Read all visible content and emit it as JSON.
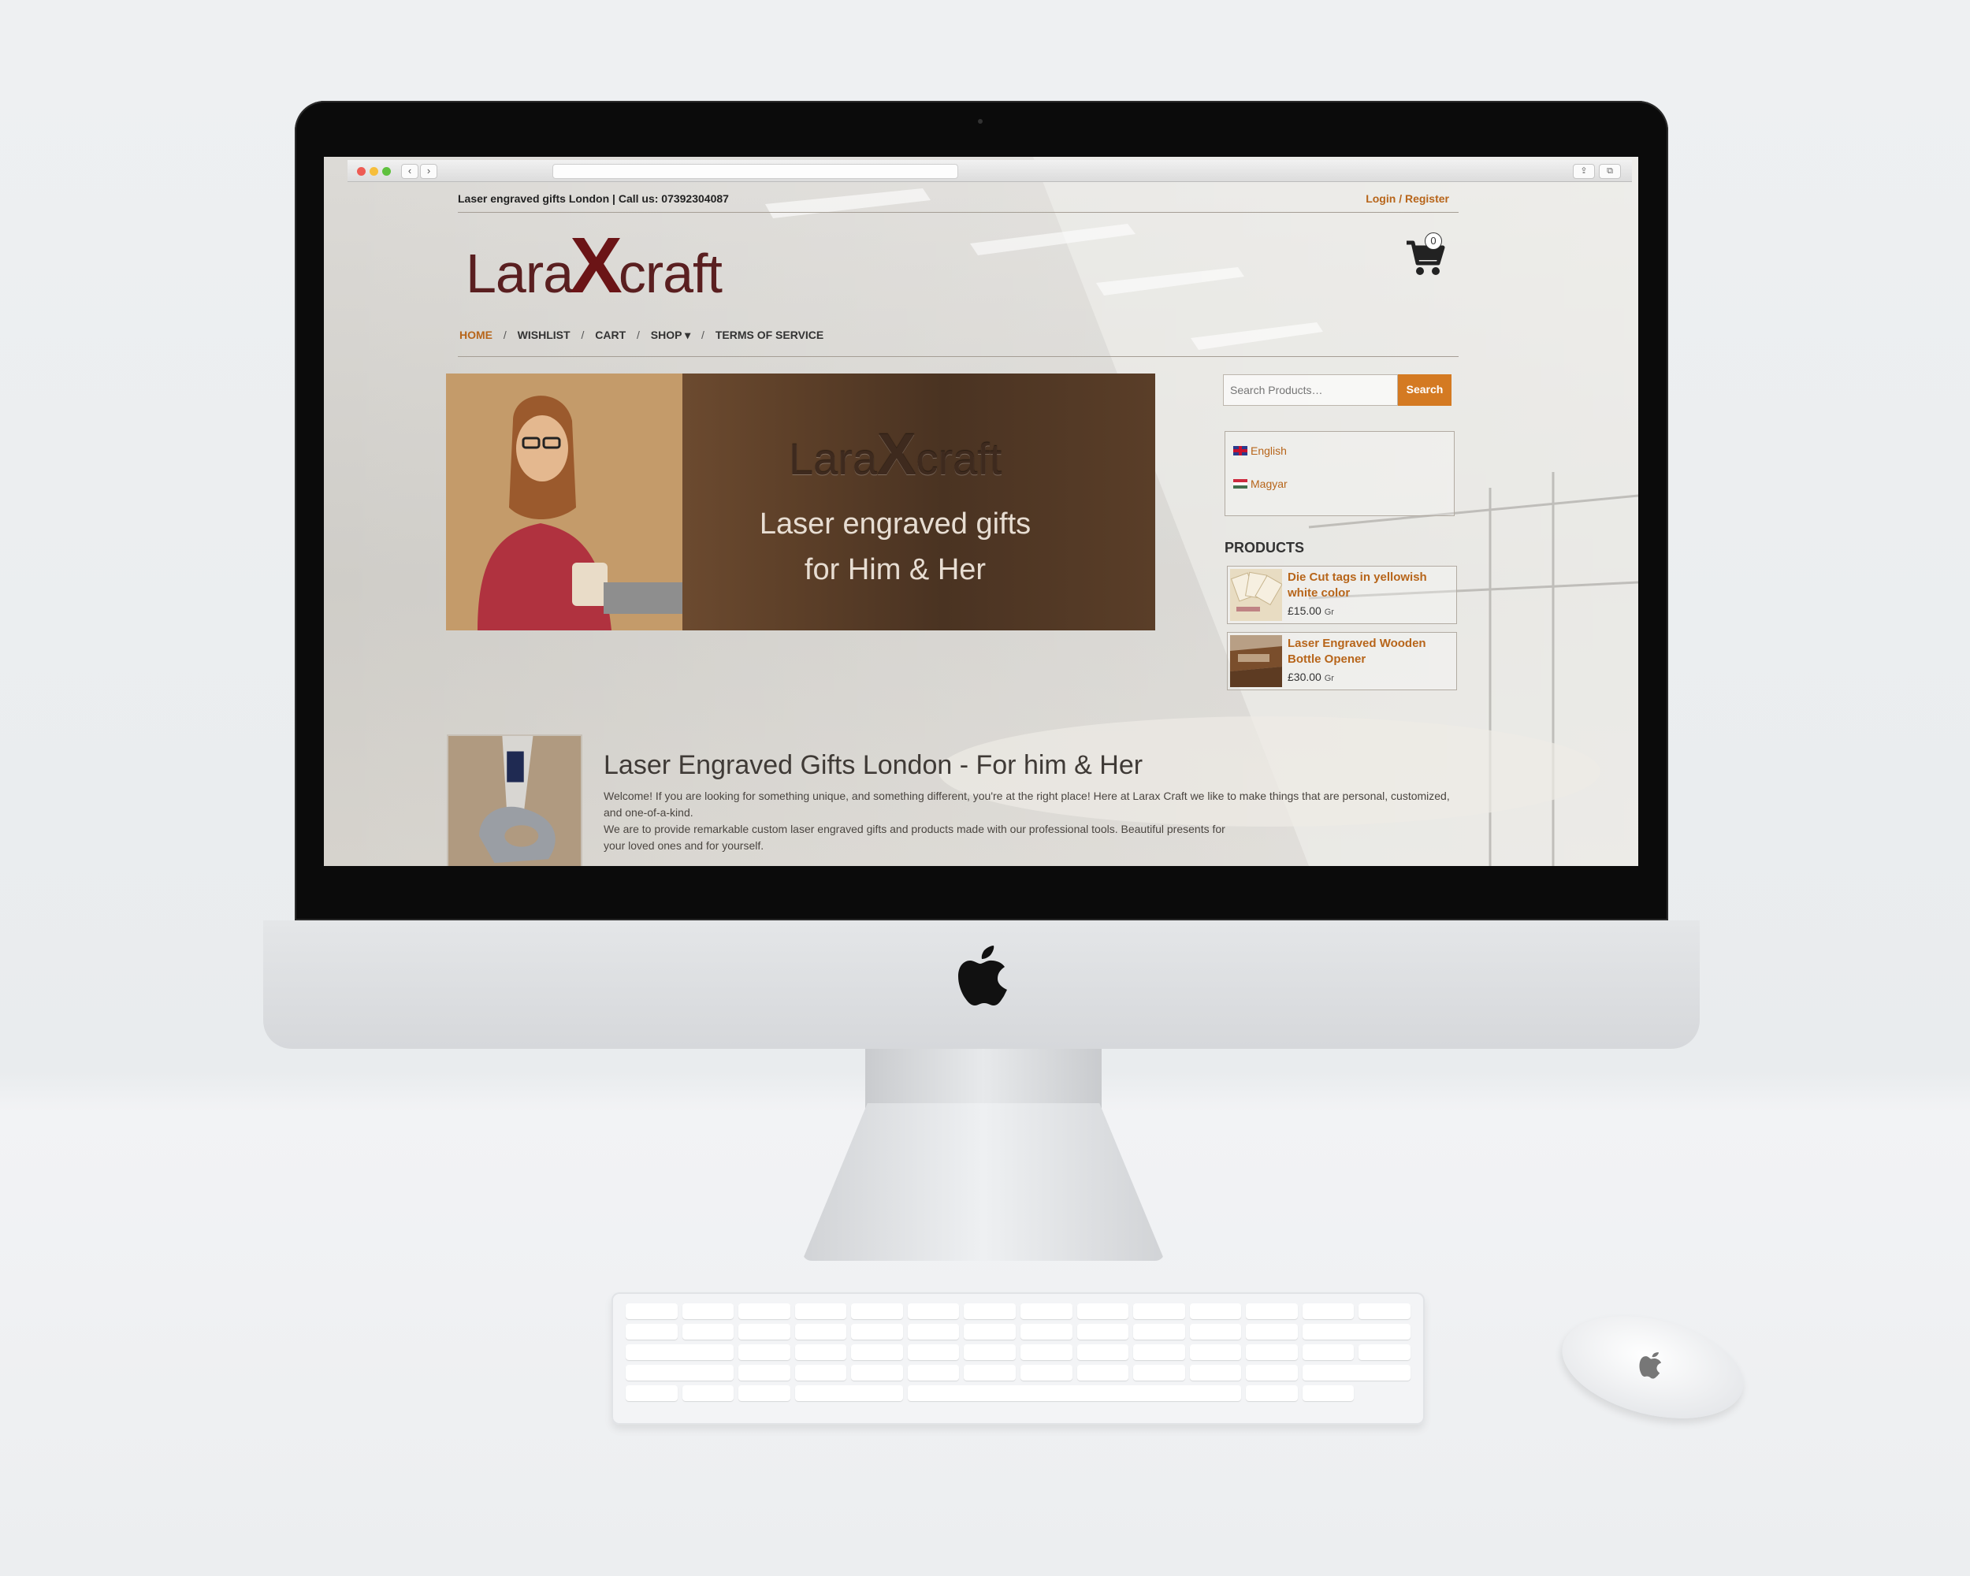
{
  "site": {
    "topbar_text": "Laser engraved gifts London | Call us: 07392304087",
    "login_link": "Login / Register",
    "logo": {
      "part1": "Lara",
      "x": "X",
      "part2": "craft"
    },
    "cart_count": "0",
    "nav": [
      {
        "label": "HOME",
        "active": true
      },
      {
        "label": "WISHLIST"
      },
      {
        "label": "CART"
      },
      {
        "label": "SHOP ▾"
      },
      {
        "label": "TERMS OF SERVICE"
      }
    ],
    "nav_separator": "/",
    "banner": {
      "logo": {
        "part1": "Lara",
        "x": "X",
        "part2": "craft"
      },
      "line1": "Laser engraved gifts",
      "line2": "for Him & Her"
    },
    "search": {
      "placeholder": "Search Products…",
      "button": "Search"
    },
    "languages": [
      "English",
      "Magyar"
    ],
    "products_title": "PRODUCTS",
    "products": [
      {
        "name": "Die Cut tags in yellowish white color",
        "price": "£15.00",
        "unit": "Gr"
      },
      {
        "name": "Laser Engraved Wooden Bottle Opener",
        "price": "£30.00",
        "unit": "Gr"
      }
    ],
    "article": {
      "title": "Laser Engraved Gifts London - For him & Her",
      "p1": "Welcome! If you are looking for something unique, and something different, you're at the right place! Here at Larax Craft we like to make things that are personal, customized, and one-of-a-kind.",
      "p2": "We are to provide remarkable custom laser engraved gifts and products made with our professional tools. Beautiful presents for your loved ones and for yourself."
    }
  },
  "colors": {
    "accent": "#b7651a",
    "search_button": "#d47a22",
    "logo": "#5a1f20"
  },
  "icons": [
    "cart-icon",
    "apple-logo-icon",
    "back-icon",
    "forward-icon",
    "share-icon",
    "tabs-icon"
  ]
}
